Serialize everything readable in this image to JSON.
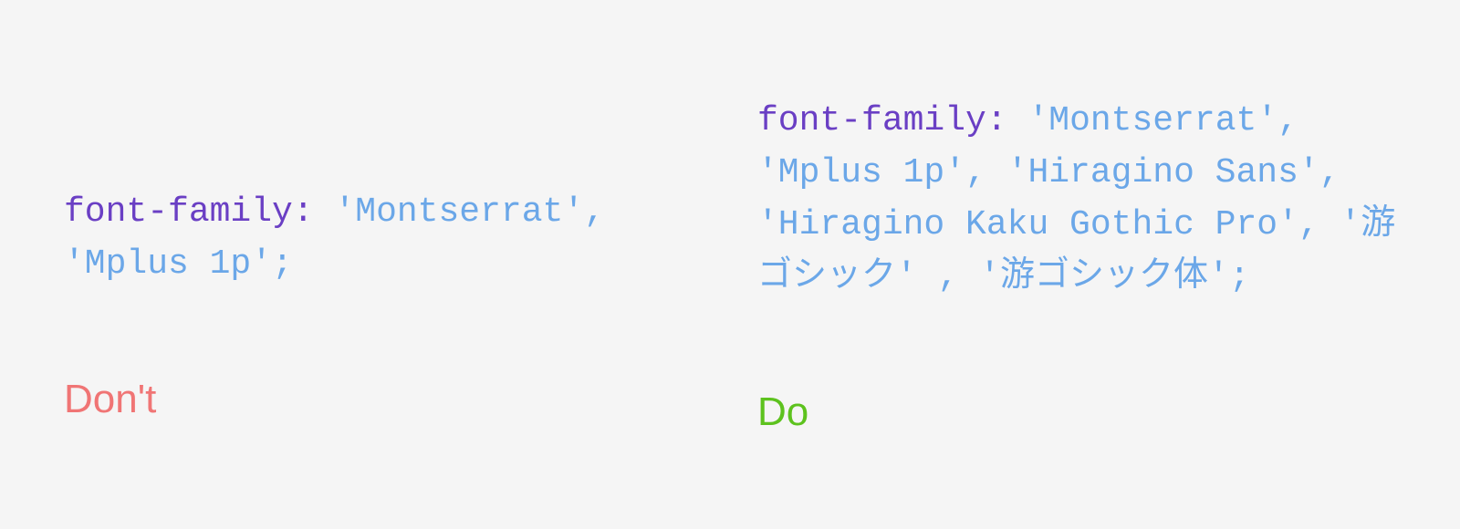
{
  "left": {
    "property": "font-family:",
    "value": " 'Montserrat', 'Mplus 1p';",
    "label": "Don't"
  },
  "right": {
    "property": "font-family:",
    "value": " 'Montserrat', 'Mplus 1p', 'Hiragino Sans', 'Hiragino Kaku Gothic Pro', '游ゴシック' , '游ゴシック体';",
    "label": "Do"
  }
}
